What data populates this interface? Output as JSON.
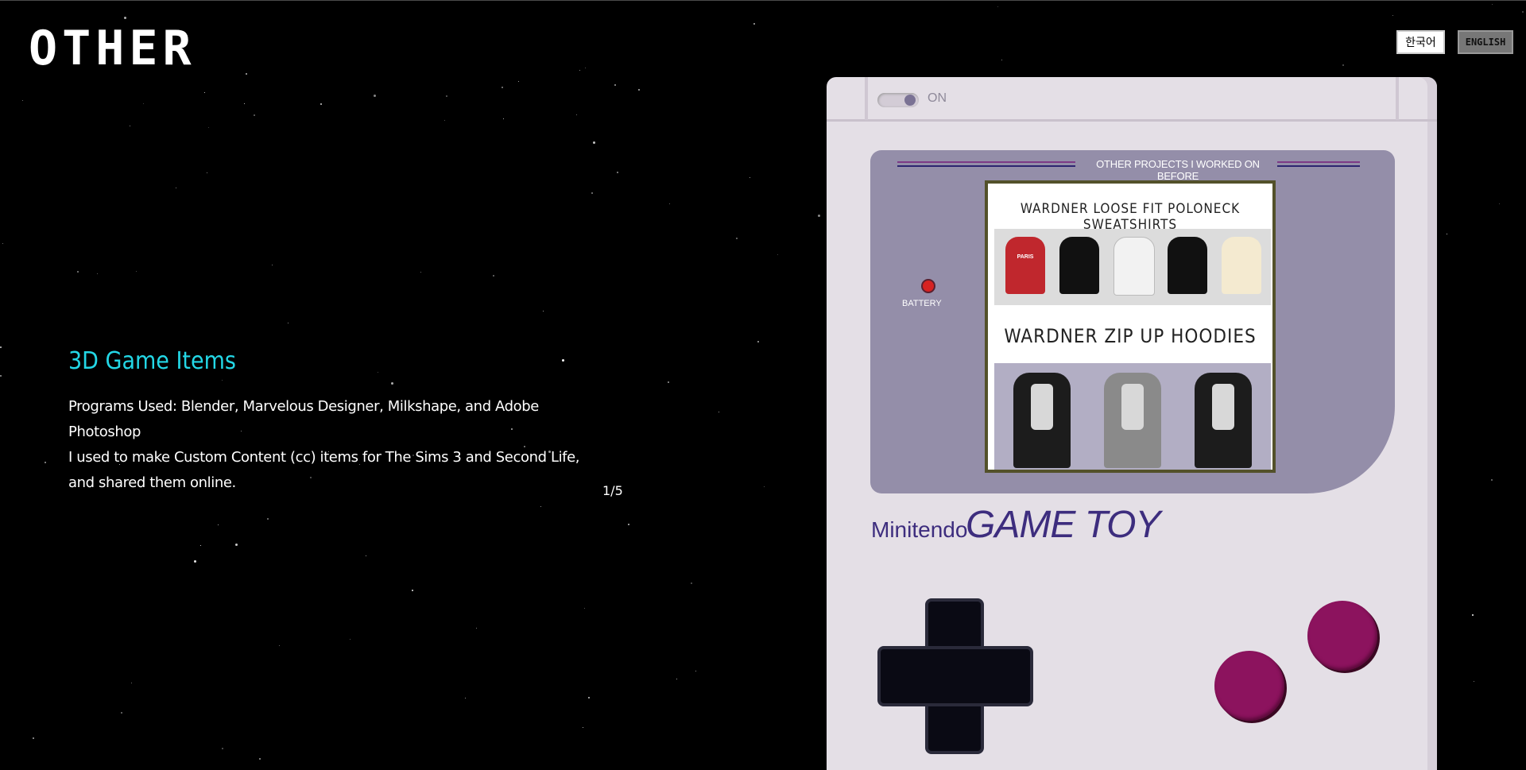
{
  "header": {
    "logo": "OTHER",
    "languages": [
      "한국어",
      "ENGLISH"
    ],
    "active_language": "ENGLISH"
  },
  "project": {
    "title": "3D Game Items",
    "programs": "Programs Used: Blender, Marvelous Designer, Milkshape, and Adobe Photoshop",
    "description": "I used to make Custom Content (cc) items for The Sims 3 and Second Life, and shared them online.",
    "pager": "1/5"
  },
  "device": {
    "power_label": "ON",
    "screen_caption": "OTHER PROJECTS I WORKED ON BEFORE",
    "battery_label": "BATTERY",
    "screen_image": {
      "heading_1": "WARDNER LOOSE FIT POLONECK SWEATSHIRTS",
      "heading_2": "WARDNER ZIP UP HOODIES",
      "shirt_print": "PARIS"
    },
    "brand_small": "Minitendo",
    "brand_big": "GAME TOY",
    "colors": {
      "body": "#e4dfe6",
      "bezel": "#948ea9",
      "brand": "#3d2d7e",
      "buttons": "#8c135e",
      "title_accent": "#23d7e6"
    }
  }
}
